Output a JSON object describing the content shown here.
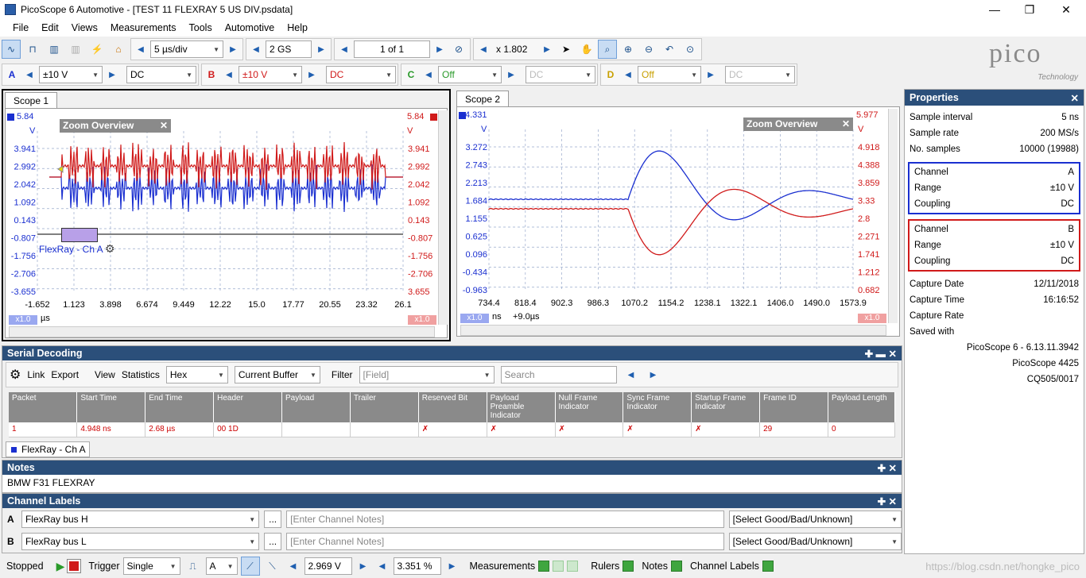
{
  "window": {
    "title": "PicoScope 6 Automotive - [TEST 11 FLEXRAY 5 US DIV.psdata]",
    "min": "—",
    "max": "❐",
    "close": "✕"
  },
  "menu": [
    "File",
    "Edit",
    "Views",
    "Measurements",
    "Tools",
    "Automotive",
    "Help"
  ],
  "toolbar": {
    "timebase": "5 µs/div",
    "samples": "2 GS",
    "buffer": "1 of 1",
    "zoom": "x 1.802"
  },
  "channels": {
    "a": {
      "label": "A",
      "range": "±10 V",
      "coupling": "DC",
      "color": "#1a2fd0"
    },
    "b": {
      "label": "B",
      "range": "±10 V",
      "coupling": "DC",
      "color": "#d01a1a"
    },
    "c": {
      "label": "C",
      "range": "Off",
      "coupling": "DC",
      "color": "#2a9a2a"
    },
    "d": {
      "label": "D",
      "range": "Off",
      "coupling": "DC",
      "color": "#c8a000"
    }
  },
  "logo": {
    "text": "pico",
    "sub": "Technology"
  },
  "scope1": {
    "tab": "Scope 1",
    "overview": "Zoom Overview",
    "left_top": "5.84",
    "left_unit": "V",
    "left_ticks": [
      "3.941",
      "2.992",
      "2.042",
      "1.092",
      "0.143",
      "-0.807",
      "-1.756",
      "-2.706",
      "-3.655"
    ],
    "right_top": "5.84",
    "right_unit": "V",
    "right_ticks": [
      "3.941",
      "2.992",
      "2.042",
      "1.092",
      "0.143",
      "-0.807",
      "-1.756",
      "-2.706",
      "3.655"
    ],
    "x_ticks": [
      "-1.652",
      "1.123",
      "3.898",
      "6.674",
      "9.449",
      "12.22",
      "15.0",
      "17.77",
      "20.55",
      "23.32",
      "26.1"
    ],
    "x_unit": "µs",
    "zoom_left": "x1.0",
    "zoom_right": "x1.0",
    "decoder_label": "FlexRay - Ch A"
  },
  "scope2": {
    "tab": "Scope 2",
    "overview": "Zoom Overview",
    "left_top": "4.331",
    "left_unit": "V",
    "left_ticks": [
      "3.272",
      "2.743",
      "2.213",
      "1.684",
      "1.155",
      "0.625",
      "0.096",
      "-0.434",
      "-0.963"
    ],
    "right_top": "5.977",
    "right_unit": "V",
    "right_ticks": [
      "4.918",
      "4.388",
      "3.859",
      "3.33",
      "2.8",
      "2.271",
      "1.741",
      "1.212",
      "0.682"
    ],
    "x_ticks": [
      "734.4",
      "818.4",
      "902.3",
      "986.3",
      "1070.2",
      "1154.2",
      "1238.1",
      "1322.1",
      "1406.0",
      "1490.0",
      "1573.9"
    ],
    "x_unit": "ns",
    "x_offset": "+9.0µs",
    "zoom_left": "x1.0",
    "zoom_right": "x1.0"
  },
  "properties": {
    "title": "Properties",
    "rows": [
      [
        "Sample interval",
        "5 ns"
      ],
      [
        "Sample rate",
        "200 MS/s"
      ],
      [
        "No. samples",
        "10000  (19988)"
      ]
    ],
    "chA": [
      [
        "Channel",
        "A"
      ],
      [
        "Range",
        "±10 V"
      ],
      [
        "Coupling",
        "DC"
      ]
    ],
    "chB": [
      [
        "Channel",
        "B"
      ],
      [
        "Range",
        "±10 V"
      ],
      [
        "Coupling",
        "DC"
      ]
    ],
    "capture": [
      [
        "Capture Date",
        "12/11/2018"
      ],
      [
        "Capture Time",
        "16:16:52"
      ],
      [
        "Capture Rate",
        ""
      ],
      [
        "Saved with",
        ""
      ]
    ],
    "saved": [
      "PicoScope 6 - 6.13.11.3942",
      "PicoScope 4425",
      "CQ505/0017"
    ]
  },
  "serial": {
    "title": "Serial Decoding",
    "toolbar": {
      "link": "Link",
      "export": "Export",
      "view": "View",
      "statistics": "Statistics",
      "format": "Hex",
      "buffer": "Current Buffer",
      "filter": "Filter",
      "field": "[Field]",
      "search": "Search"
    },
    "headers": [
      "Packet",
      "Start Time",
      "End Time",
      "Header",
      "Payload",
      "Trailer",
      "Reserved Bit",
      "Payload Preamble Indicator",
      "Null Frame Indicator",
      "Sync Frame Indicator",
      "Startup Frame Indicator",
      "Frame ID",
      "Payload Length"
    ],
    "row": [
      "1",
      "4.948 ns",
      "2.68 µs",
      "00 1D",
      "",
      "",
      "✗",
      "✗",
      "✗",
      "✗",
      "✗",
      "29",
      "0"
    ],
    "tab": "FlexRay - Ch A"
  },
  "notes": {
    "title": "Notes",
    "text": "BMW F31 FLEXRAY"
  },
  "labels": {
    "title": "Channel Labels",
    "rows": [
      {
        "ch": "A",
        "name": "FlexRay bus H",
        "notes": "[Enter Channel Notes]",
        "status": "[Select Good/Bad/Unknown]"
      },
      {
        "ch": "B",
        "name": "FlexRay bus L",
        "notes": "[Enter Channel Notes]",
        "status": "[Select Good/Bad/Unknown]"
      }
    ],
    "more": "..."
  },
  "status": {
    "state": "Stopped",
    "trigger": "Trigger",
    "mode": "Single",
    "src": "A",
    "level": "2.969 V",
    "pre": "3.351 %",
    "measurements": "Measurements",
    "rulers": "Rulers",
    "notes": "Notes",
    "channel_labels": "Channel Labels",
    "watermark": "https://blog.csdn.net/hongke_pico"
  }
}
